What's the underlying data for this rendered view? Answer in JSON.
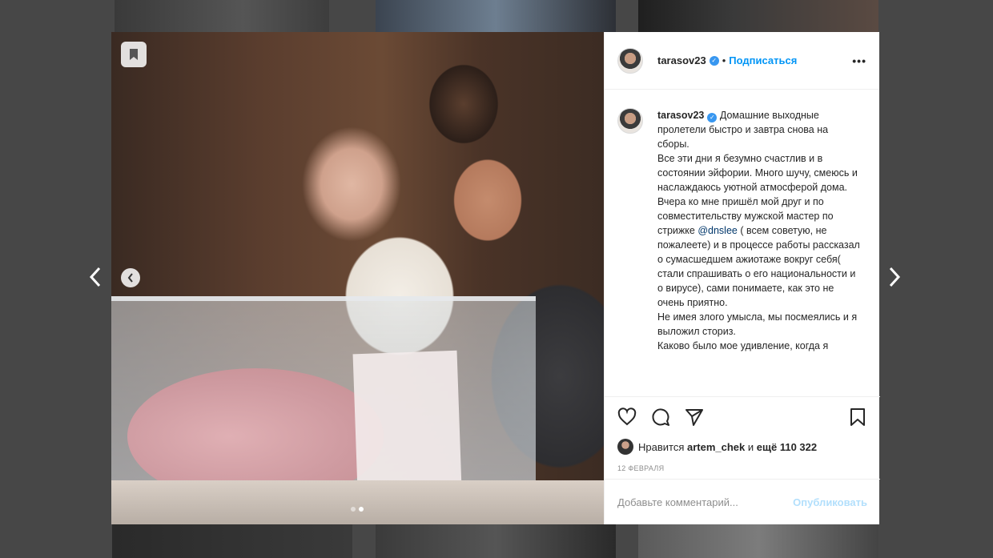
{
  "post": {
    "username": "tarasov23",
    "verified_mark": "✓",
    "separator": "•",
    "follow_label": "Подписаться",
    "more_label": "•••",
    "caption_username": "tarasov23",
    "caption_paragraphs": [
      "Домашние выходные пролетели быстро и завтра снова на сборы.",
      "Все эти дни я безумно счастлив и в состоянии эйфории. Много шучу, смеюсь и наслаждаюсь уютной атмосферой дома.",
      "Вчера ко мне пришёл мой друг и по совместительству мужской мастер по стрижке",
      "( всем советую, не пожалеете) и в процессе работы рассказал о сумасшедшем ажиотаже вокруг себя( стали спрашивать о его национальности и о вирусе), сами понимаете, как это не очень приятно.",
      "Не имея злого умысла, мы посмеялись и я выложил сториз.",
      "Каково было мое удивление, когда я"
    ],
    "mention": "@dnslee",
    "likes_prefix": "Нравится",
    "likes_user": "artem_chek",
    "likes_middle": "и",
    "likes_count": "ещё 110 322",
    "date": "12 ФЕВРАЛЯ",
    "comment_placeholder": "Добавьте комментарий...",
    "publish_label": "Опубликовать"
  },
  "carousel": {
    "total": 2,
    "active_index": 1
  },
  "icons": {
    "save": "bookmark-icon",
    "prev_image": "chevron-left-icon",
    "prev_post": "chevron-left-icon",
    "next_post": "chevron-right-icon",
    "like": "heart-icon",
    "comment": "comment-icon",
    "share": "send-icon",
    "bookmark": "bookmark-icon"
  },
  "colors": {
    "accent": "#0095f6",
    "publish_disabled": "#b2dffc",
    "muted": "#8e8e8e",
    "backdrop": "#474747"
  }
}
